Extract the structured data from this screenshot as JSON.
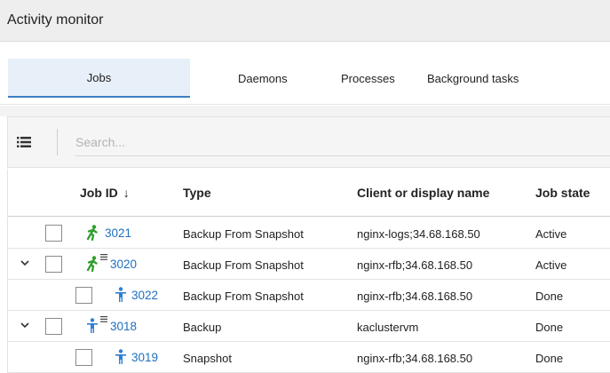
{
  "window": {
    "title": "Activity monitor"
  },
  "tabs": [
    {
      "label": "Jobs",
      "active": true
    },
    {
      "label": "Daemons",
      "active": false
    },
    {
      "label": "Processes",
      "active": false
    },
    {
      "label": "Background tasks",
      "active": false
    }
  ],
  "toolbar": {
    "search_placeholder": "Search...",
    "list_icon": "list-icon"
  },
  "table": {
    "columns": [
      "Job ID",
      "Type",
      "Client or display name",
      "Job state"
    ],
    "sort": {
      "column": "Job ID",
      "direction": "descending",
      "arrow": "↓"
    },
    "rows": [
      {
        "job_id": "3021",
        "type": "Backup From Snapshot",
        "client": "nginx-logs;34.68.168.50",
        "state": "Active",
        "icon": "running-job-icon",
        "expandable": false,
        "has_subjobs": false,
        "indent": 0
      },
      {
        "job_id": "3020",
        "type": "Backup From Snapshot",
        "client": "nginx-rfb;34.68.168.50",
        "state": "Active",
        "icon": "running-job-icon",
        "expandable": true,
        "has_subjobs": true,
        "indent": 0
      },
      {
        "job_id": "3022",
        "type": "Backup From Snapshot",
        "client": "nginx-rfb;34.68.168.50",
        "state": "Done",
        "icon": "completed-job-icon",
        "expandable": false,
        "has_subjobs": false,
        "indent": 1
      },
      {
        "job_id": "3018",
        "type": "Backup",
        "client": "kaclustervm",
        "state": "Done",
        "icon": "completed-job-icon",
        "expandable": true,
        "has_subjobs": true,
        "indent": 0
      },
      {
        "job_id": "3019",
        "type": "Snapshot",
        "client": "nginx-rfb;34.68.168.50",
        "state": "Done",
        "icon": "completed-job-icon",
        "expandable": false,
        "has_subjobs": false,
        "indent": 1
      }
    ]
  },
  "colors": {
    "link": "#1f6fbf",
    "active_icon": "#2e9d2e",
    "done_icon": "#2f7fd1",
    "tab_active": "#3d7fc4"
  }
}
